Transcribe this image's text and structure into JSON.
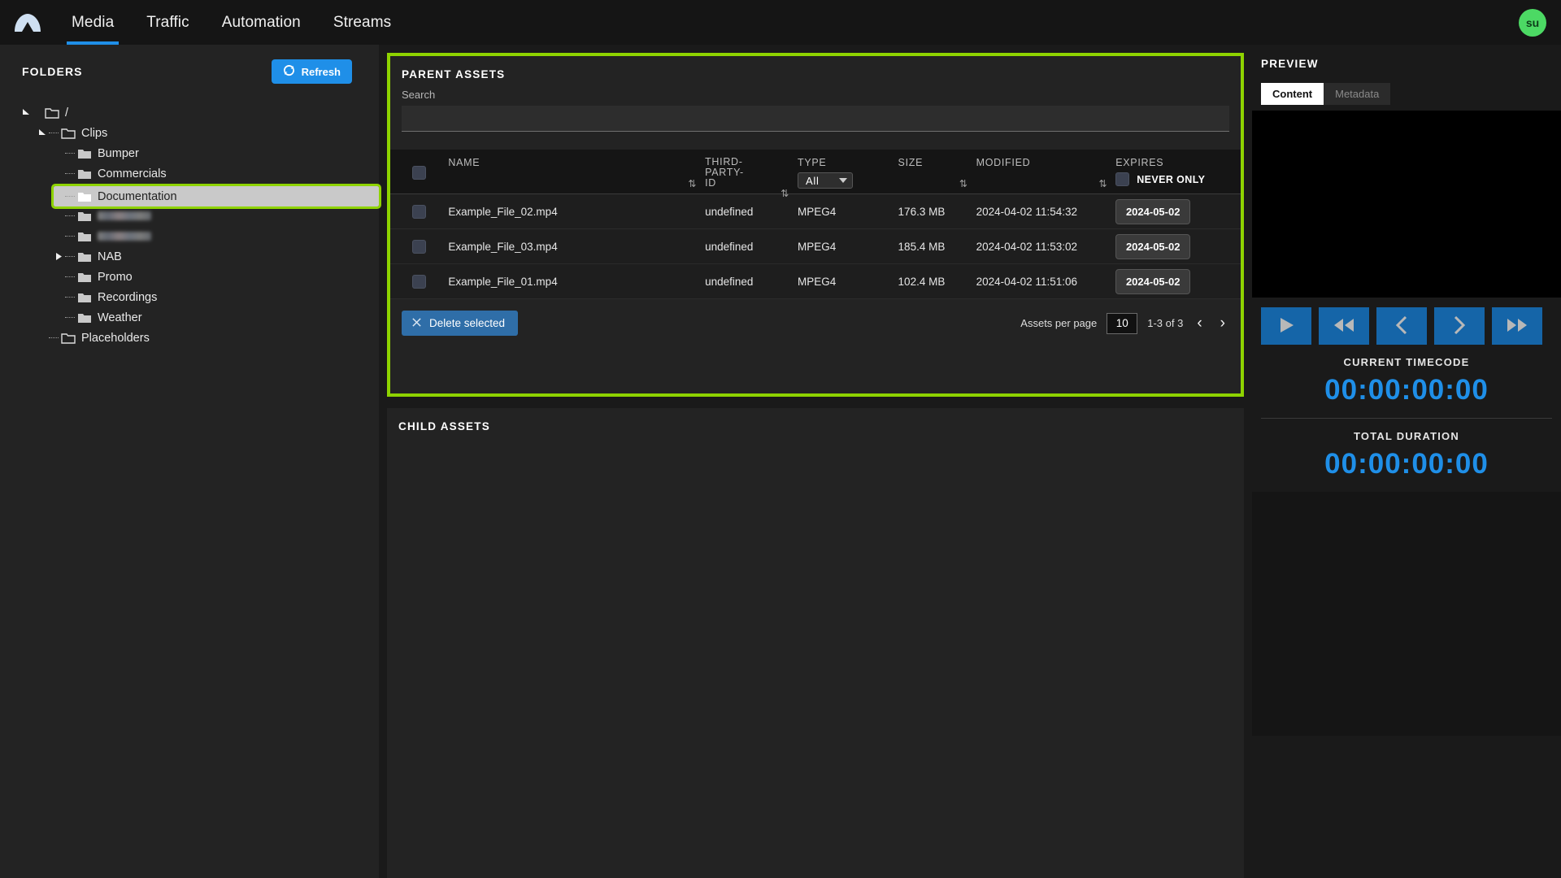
{
  "app": {
    "logo_icon": "mountain-logo",
    "avatar_initials": "su"
  },
  "nav": {
    "items": [
      {
        "label": "Media",
        "active": true
      },
      {
        "label": "Traffic",
        "active": false
      },
      {
        "label": "Automation",
        "active": false
      },
      {
        "label": "Streams",
        "active": false
      }
    ]
  },
  "sidebar": {
    "title": "FOLDERS",
    "refresh_label": "Refresh",
    "refresh_icon": "refresh-icon",
    "tree": [
      {
        "label": "/",
        "depth": 0,
        "arrow": "down",
        "selected": false,
        "redacted": false
      },
      {
        "label": "Clips",
        "depth": 1,
        "arrow": "down",
        "selected": false,
        "redacted": false
      },
      {
        "label": "Bumper",
        "depth": 2,
        "arrow": "none",
        "selected": false,
        "redacted": false
      },
      {
        "label": "Commercials",
        "depth": 2,
        "arrow": "none",
        "selected": false,
        "redacted": false
      },
      {
        "label": "Documentation",
        "depth": 2,
        "arrow": "none",
        "selected": true,
        "redacted": false
      },
      {
        "label": "",
        "depth": 2,
        "arrow": "none",
        "selected": false,
        "redacted": true
      },
      {
        "label": "",
        "depth": 2,
        "arrow": "none",
        "selected": false,
        "redacted": true
      },
      {
        "label": "NAB",
        "depth": 2,
        "arrow": "right",
        "selected": false,
        "redacted": false
      },
      {
        "label": "Promo",
        "depth": 2,
        "arrow": "none",
        "selected": false,
        "redacted": false
      },
      {
        "label": "Recordings",
        "depth": 2,
        "arrow": "none",
        "selected": false,
        "redacted": false
      },
      {
        "label": "Weather",
        "depth": 2,
        "arrow": "none",
        "selected": false,
        "redacted": false
      },
      {
        "label": "Placeholders",
        "depth": 1,
        "arrow": "none",
        "selected": false,
        "redacted": false
      }
    ]
  },
  "parent_assets": {
    "title": "PARENT ASSETS",
    "search_label": "Search",
    "search_value": "",
    "search_placeholder": "",
    "columns": {
      "name": "NAME",
      "third_party_id": "THIRD-PARTY-ID",
      "type": "TYPE",
      "size": "SIZE",
      "modified": "MODIFIED",
      "expires": "EXPIRES"
    },
    "type_filter_value": "All",
    "never_only_label": "NEVER ONLY",
    "never_only_checked": false,
    "select_all_checked": false,
    "rows": [
      {
        "checked": false,
        "name": "Example_File_02.mp4",
        "third_party_id": "undefined",
        "type": "MPEG4",
        "size": "176.3 MB",
        "modified": "2024-04-02 11:54:32",
        "expires": "2024-05-02"
      },
      {
        "checked": false,
        "name": "Example_File_03.mp4",
        "third_party_id": "undefined",
        "type": "MPEG4",
        "size": "185.4 MB",
        "modified": "2024-04-02 11:53:02",
        "expires": "2024-05-02"
      },
      {
        "checked": false,
        "name": "Example_File_01.mp4",
        "third_party_id": "undefined",
        "type": "MPEG4",
        "size": "102.4 MB",
        "modified": "2024-04-02 11:51:06",
        "expires": "2024-05-02"
      }
    ],
    "delete_label": "Delete selected",
    "delete_icon": "close-x-icon",
    "per_page_label": "Assets per page",
    "per_page_value": "10",
    "range_label": "1-3 of 3",
    "prev_icon": "chevron-left-icon",
    "next_icon": "chevron-right-icon"
  },
  "child_assets": {
    "title": "CHILD ASSETS"
  },
  "preview": {
    "title": "PREVIEW",
    "tabs": [
      {
        "label": "Content",
        "active": true
      },
      {
        "label": "Metadata",
        "active": false
      }
    ],
    "transport": [
      {
        "icon": "play-icon"
      },
      {
        "icon": "rewind-icon"
      },
      {
        "icon": "step-back-icon"
      },
      {
        "icon": "step-forward-icon"
      },
      {
        "icon": "fast-forward-icon"
      }
    ],
    "current_timecode_label": "CURRENT TIMECODE",
    "current_timecode_value": "00:00:00:00",
    "total_duration_label": "TOTAL DURATION",
    "total_duration_value": "00:00:00:00"
  },
  "colors": {
    "accent_blue": "#1f8fe8",
    "highlight_green": "#8ed300",
    "avatar_green": "#4cd964",
    "panel_bg": "#232323",
    "page_bg": "#1a1a1a"
  }
}
